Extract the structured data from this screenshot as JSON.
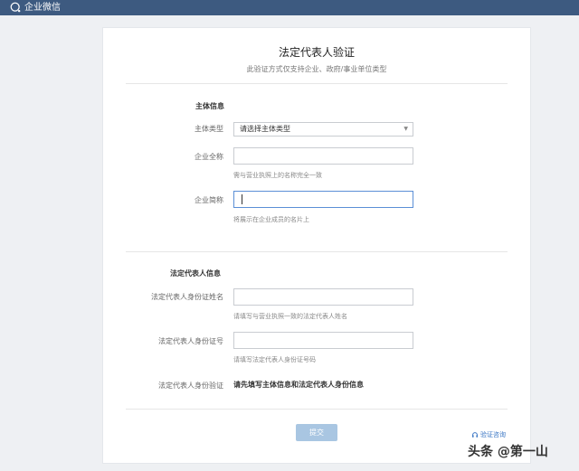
{
  "topbar": {
    "brand": "企业微信",
    "logo_icon": "wecom-logo-icon"
  },
  "card": {
    "title": "法定代表人验证",
    "subtitle": "此验证方式仅支持企业、政府/事业单位类型"
  },
  "entity_section": {
    "title": "主体信息",
    "type_label": "主体类型",
    "type_value": "请选择主体类型",
    "fullname_label": "企业全称",
    "fullname_value": "",
    "fullname_hint": "需与营业执照上的名称完全一致",
    "shortname_label": "企业简称",
    "shortname_value": "",
    "shortname_hint": "将展示在企业成员的名片上"
  },
  "rep_section": {
    "title": "法定代表人信息",
    "name_label": "法定代表人身份证姓名",
    "name_value": "",
    "name_hint": "请填写与营业执照一致的法定代表人姓名",
    "id_label": "法定代表人身份证号",
    "id_value": "",
    "id_hint": "请填写法定代表人身份证号码",
    "verify_label": "法定代表人身份验证",
    "verify_text": "请先填写主体信息和法定代表人身份信息"
  },
  "actions": {
    "submit_label": "提交",
    "help_label": "验证咨询"
  },
  "watermark": "头条 @第一山",
  "colors": {
    "topbar": "#3d5a80",
    "submit": "#a9c6e2",
    "link": "#3a76c4"
  }
}
